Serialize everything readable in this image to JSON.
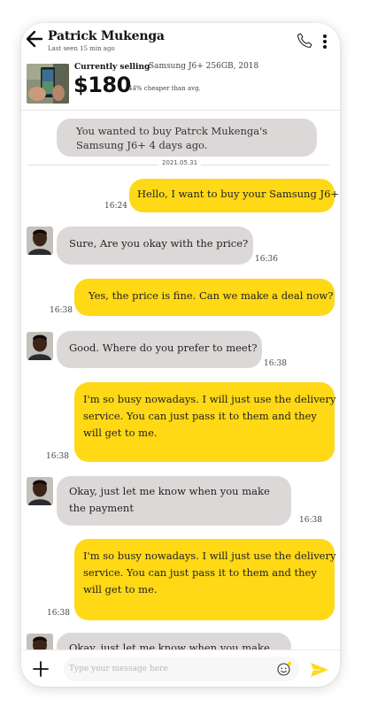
{
  "header": {
    "contact_name": "Patrick Mukenga",
    "last_seen": "Last seen 15 min ago"
  },
  "listing": {
    "label": "Currently selling",
    "product": "Samsung J6+ 256GB, 2018",
    "price": "$180",
    "discount": "44% cheaper than avg."
  },
  "notice": {
    "line1": "You wanted to buy Patrck Mukenga's",
    "line2": "Samsung J6+ 4 days ago."
  },
  "date_separator": "2021.05.31",
  "messages": [
    {
      "lines": [
        "Hello, I want to buy your Samsung J6+"
      ],
      "time": "16:24"
    },
    {
      "lines": [
        "Sure, Are you okay with the price?"
      ],
      "time": "16:36"
    },
    {
      "lines": [
        "Yes, the price is fine. Can we make a deal now?"
      ],
      "time": "16:38"
    },
    {
      "lines": [
        "Good. Where do you prefer to meet?"
      ],
      "time": "16:38"
    },
    {
      "lines": [
        "I'm so busy nowadays. I will just use the delivery",
        "service. You can just pass it to them and they",
        "will get to me."
      ],
      "time": "16:38"
    },
    {
      "lines": [
        "Okay, just let me know when you make",
        "the payment"
      ],
      "time": "16:38"
    },
    {
      "lines": [
        "I'm so busy nowadays. I will just use the delivery",
        "service. You can just pass it to them and they",
        "will get to me."
      ],
      "time": "16:38"
    },
    {
      "lines": [
        "Okay, just let me know when you make"
      ],
      "time": ""
    }
  ],
  "composer": {
    "placeholder": "Type your message here"
  },
  "colors": {
    "outgoing_bubble": "#ffd816",
    "incoming_bubble": "#dcd8d8",
    "send_icon": "#ffd816"
  }
}
